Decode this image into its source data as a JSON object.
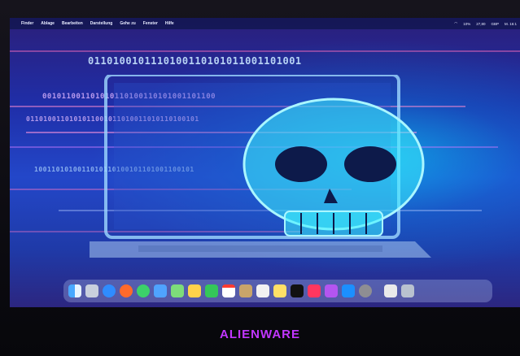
{
  "menubar": {
    "apple": "",
    "items": [
      "Finder",
      "Ablage",
      "Bearbeiten",
      "Darstellung",
      "Gehe zu",
      "Fenster",
      "Hilfe"
    ],
    "status": [
      "10%",
      "27,80",
      "GBP",
      "M. 16:1"
    ]
  },
  "wallpaper": {
    "binary_rows": [
      "0110100101110100110101011001101001",
      "001011001101010110100110101001101100",
      "0110100110101011001011010011010110100101",
      "1001101010011010110100101101001100101"
    ]
  },
  "dock": {
    "icons": [
      "finder-icon",
      "launchpad-icon",
      "safari-icon",
      "firefox-icon",
      "messages-icon",
      "mail-icon",
      "maps-icon",
      "photos-icon",
      "facetime-icon",
      "calendar-icon",
      "contacts-icon",
      "reminders-icon",
      "notes-icon",
      "tv-icon",
      "music-icon",
      "podcasts-icon",
      "appstore-icon",
      "settings-icon",
      "file-icon",
      "trash-icon"
    ]
  },
  "brand": {
    "label": "ALIENWARE"
  },
  "colors": {
    "brand": "#c236ff",
    "glow": "#22e6ff"
  }
}
